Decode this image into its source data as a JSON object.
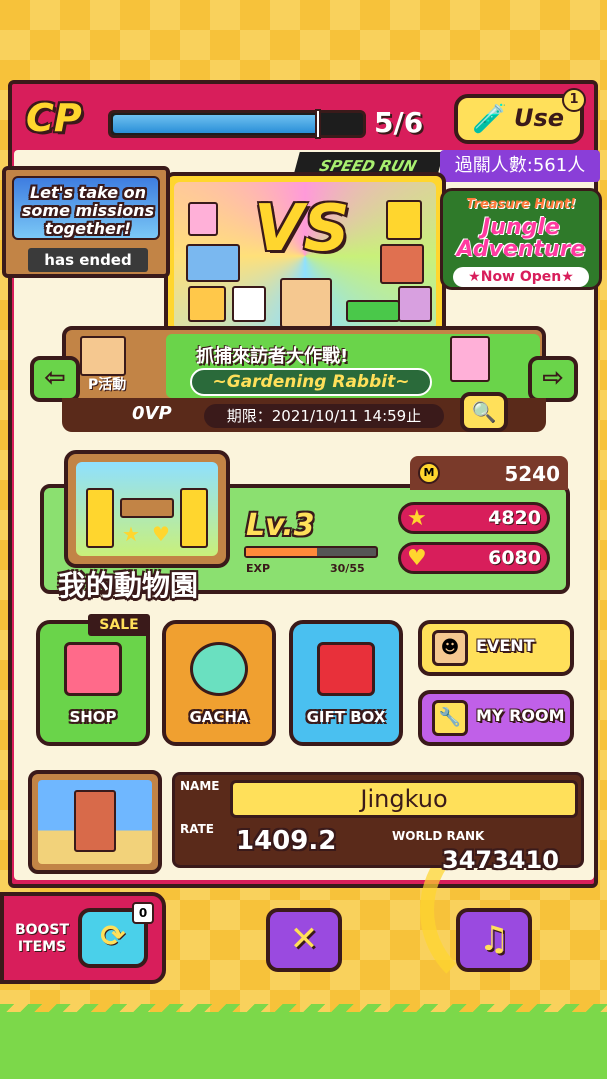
{
  "colors": {
    "panel": "#d81e5b",
    "accent_yellow": "#ffe05a",
    "grass_green": "#7cd84a",
    "outline": "#3a1a1a"
  },
  "cp": {
    "label": "CP",
    "current": 5,
    "max": 6,
    "count_text": "5/6",
    "fill_fraction": 0.83,
    "use_button_label": "Use",
    "use_icon": "potion-icon",
    "use_badge": "1"
  },
  "banner": {
    "speed_run": "SPEED RUN",
    "clear_count": "過關人數:561人",
    "vs_text": "VS"
  },
  "missions": {
    "title": "Let's take on some missions together!",
    "status": "has ended"
  },
  "ad": {
    "line1": "Treasure Hunt!",
    "line2": "Jungle Adventure",
    "line3": "★Now Open★"
  },
  "event": {
    "title": "抓捕來訪者大作戰!",
    "subtitle": "~Gardening Rabbit~",
    "p_label": "P活動",
    "vp": "0VP",
    "deadline": "期限：2021/10/11 14:59止",
    "prev_icon": "arrow-left-icon",
    "next_icon": "arrow-right-icon",
    "search_icon": "magnifier-icon"
  },
  "zoo": {
    "name": "我的動物園",
    "coins": "5240",
    "level": "Lv.3",
    "exp_label": "EXP",
    "exp_text": "30/55",
    "exp_fraction": 0.545,
    "stars": "4820",
    "hearts": "6080"
  },
  "buttons": {
    "sale": "SALE",
    "shop": "SHOP",
    "gacha": "GACHA",
    "gift_box": "GIFT BOX",
    "event": "EVENT",
    "my_room": "MY ROOM"
  },
  "profile": {
    "name_label": "NAME",
    "name": "Jingkuo",
    "rate_label": "RATE",
    "rate": "1409.2",
    "rank_label": "WORLD RANK",
    "rank": "3473410"
  },
  "bottom": {
    "boost_label": "BOOST ITEMS",
    "boost_badge": "0",
    "close_icon": "close-icon",
    "music_icon": "music-note-icon"
  }
}
